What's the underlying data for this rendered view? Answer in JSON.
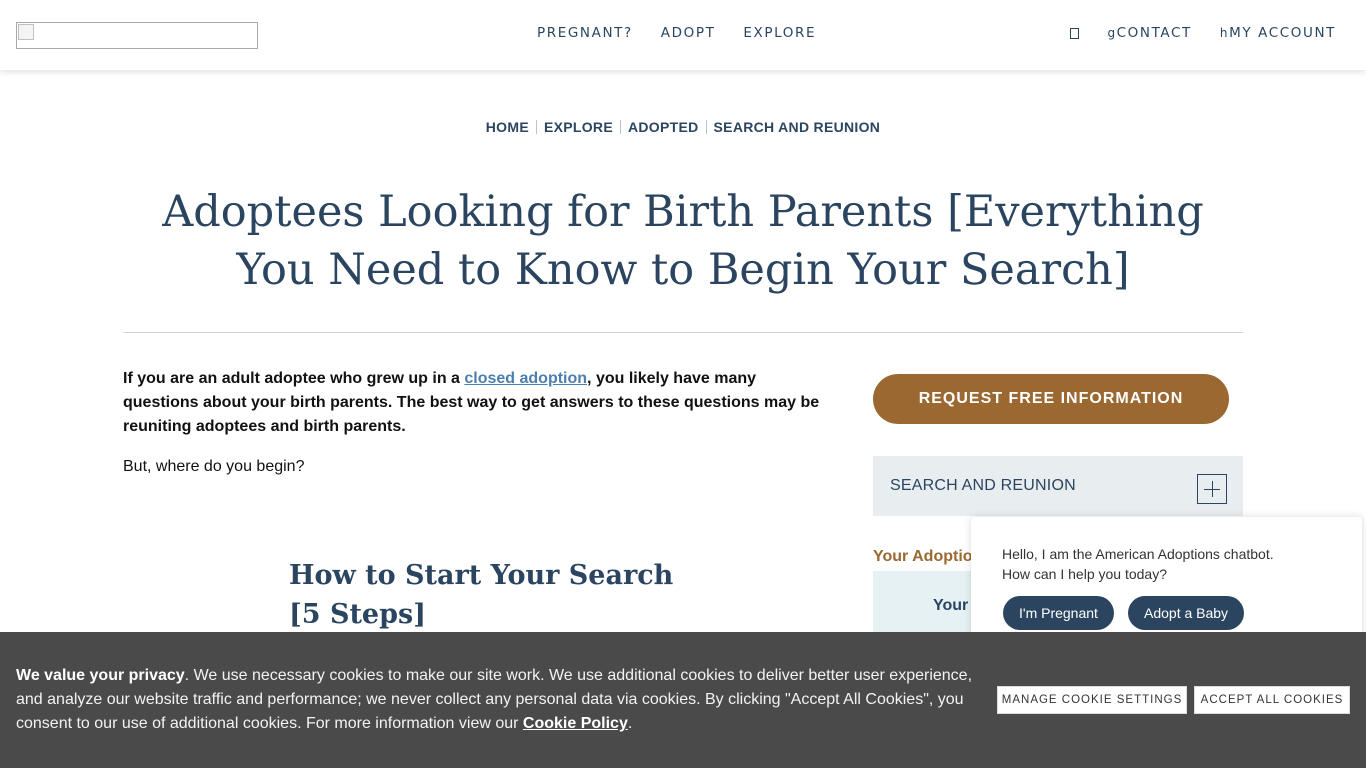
{
  "header": {
    "logo_alt": "",
    "nav": [
      "PREGNANT?",
      "ADOPT",
      "EXPLORE"
    ],
    "contact_label": "CONTACT",
    "contact_glyph": "g",
    "account_label": "MY ACCOUNT",
    "account_glyph": "h"
  },
  "breadcrumb": [
    "HOME",
    "EXPLORE",
    "ADOPTED",
    "SEARCH AND REUNION"
  ],
  "page": {
    "title": "Adoptees Looking for Birth Parents [Everything You Need to Know to Begin Your Search]",
    "intro_before_link": "If you are an adult adoptee who grew up in a ",
    "intro_link": "closed adoption",
    "intro_after_link": ", you likely have many questions about your birth parents. The best way to get answers to these questions may be reuniting adoptees and birth parents.",
    "question": "But, where do you begin?",
    "section_title": "How to Start Your Search [5 Steps]"
  },
  "sidebar": {
    "cta_label": "REQUEST FREE INFORMATION",
    "accordion_label": "SEARCH AND REUNION",
    "image_alt": "Your Adoption",
    "card_text": "Your"
  },
  "chatbot": {
    "message_line1": "Hello, I am the American Adoptions chatbot.",
    "message_line2": "How can I help you today?",
    "buttons": [
      "I'm Pregnant",
      "Adopt a Baby"
    ]
  },
  "cookies": {
    "lead": "We value your privacy",
    "body": ". We use necessary cookies to make our site work. We use additional cookies to deliver better user experience, and analyze our website traffic and performance; we never collect any personal data via cookies. By clicking \"Accept All Cookies\", you consent to our use of additional cookies. For more information view our ",
    "policy_link": "Cookie Policy",
    "end": ".",
    "manage_label": "MANAGE COOKIE SETTINGS",
    "accept_label": "ACCEPT ALL COOKIES"
  },
  "colors": {
    "navy": "#2b4560",
    "brown": "#9a6830",
    "link_blue": "#4a7fb0",
    "banner_gray": "#4a4a4a"
  }
}
